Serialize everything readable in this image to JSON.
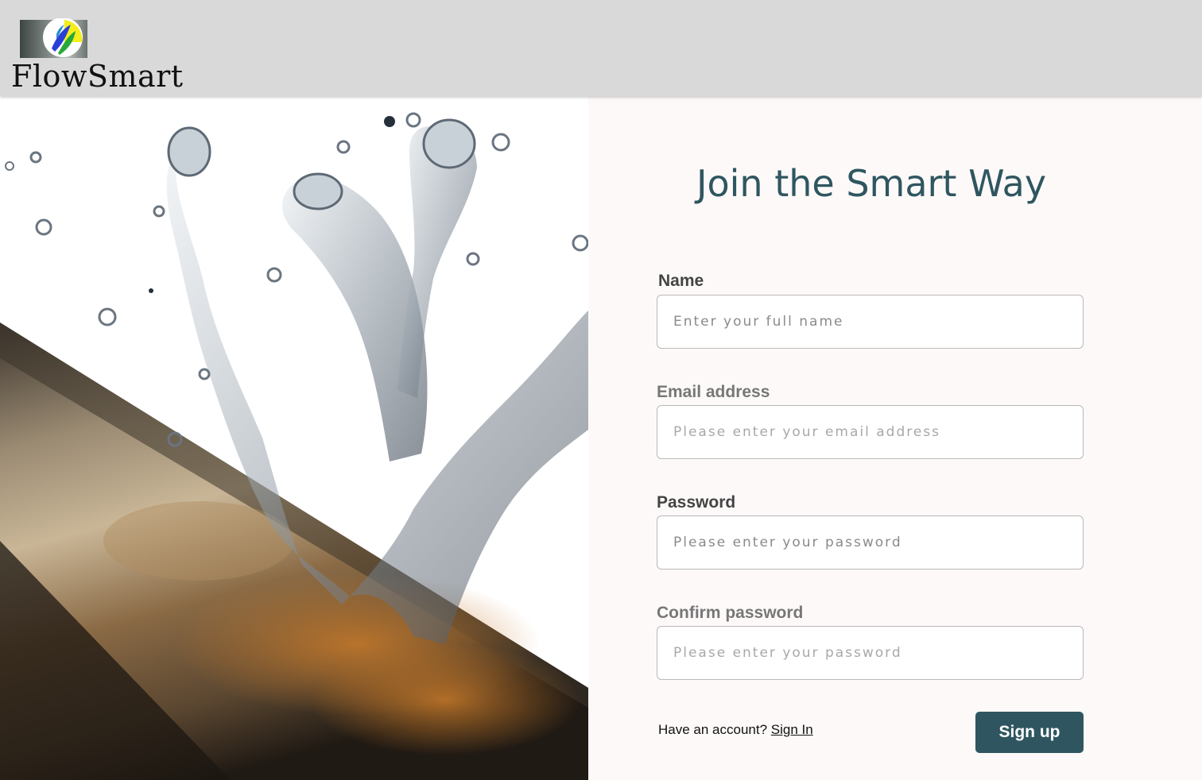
{
  "header": {
    "brand_name": "FlowSmart",
    "logo_icon": "flowsmart-logo-icon"
  },
  "hero": {
    "image_icon": "water-splash-pipe-image"
  },
  "form": {
    "title": "Join the Smart Way",
    "fields": [
      {
        "label": "Name",
        "placeholder": "Enter your full name",
        "value": ""
      },
      {
        "label": "Email address",
        "placeholder": "Please enter your email address",
        "value": ""
      },
      {
        "label": "Password",
        "placeholder": "Please enter your password",
        "value": ""
      },
      {
        "label": "Confirm password",
        "placeholder": "Please enter your password",
        "value": ""
      }
    ],
    "account_prompt": "Have an account?",
    "signin_link": "Sign In",
    "submit_label": "Sign up"
  },
  "colors": {
    "accent": "#2f5660",
    "header_bg": "#d9d9d9",
    "panel_bg": "#fdf9f8"
  }
}
